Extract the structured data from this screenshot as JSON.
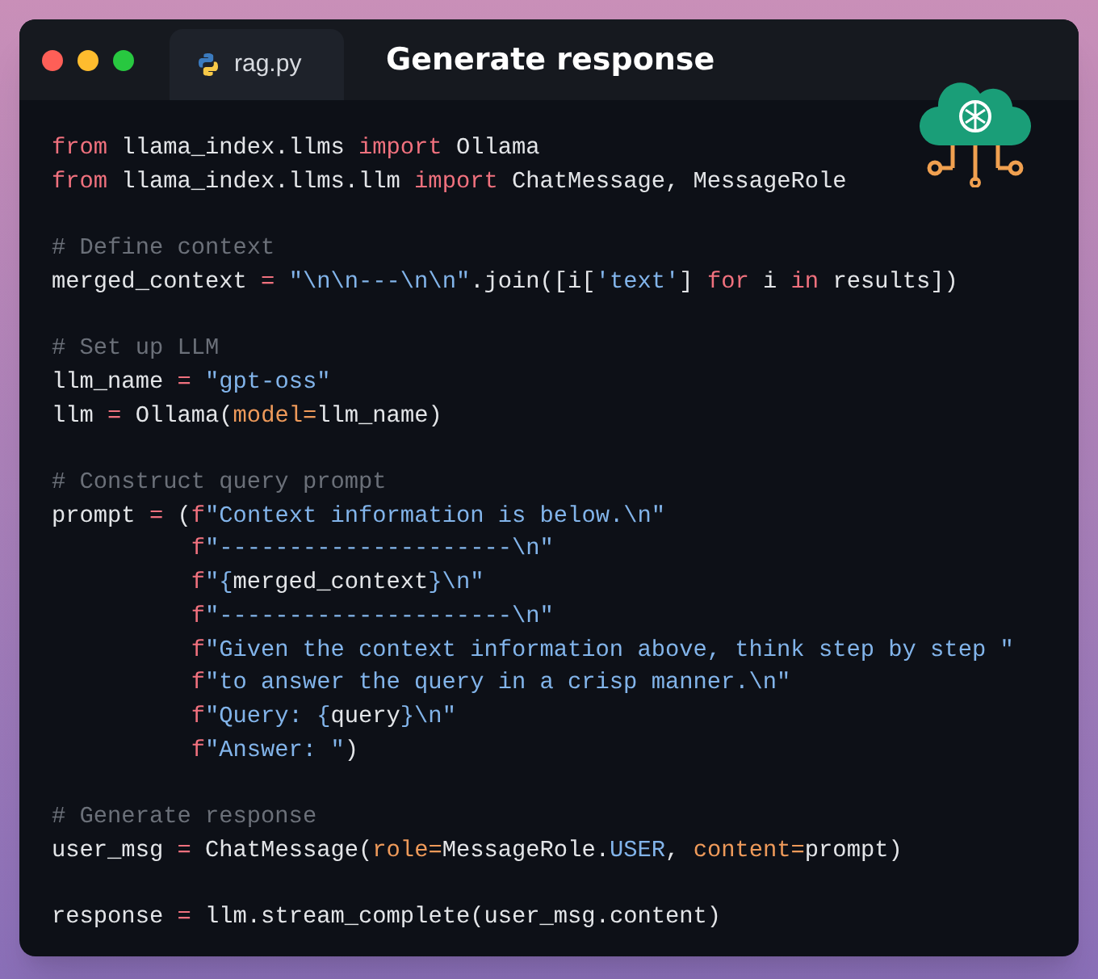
{
  "window": {
    "tab": {
      "label": "rag.py",
      "selected": true
    },
    "title": "Generate response"
  },
  "code": {
    "blocks": [
      {
        "lines": [
          {
            "indented": false,
            "tokens": [
              {
                "kind": "kw",
                "text": "from"
              },
              {
                "kind": "plain",
                "text": " llama_index.llms "
              },
              {
                "kind": "kw",
                "text": "import"
              },
              {
                "kind": "plain",
                "text": " Ollama"
              }
            ]
          },
          {
            "indented": false,
            "tokens": [
              {
                "kind": "kw",
                "text": "from"
              },
              {
                "kind": "plain",
                "text": " llama_index.llms.llm "
              },
              {
                "kind": "kw",
                "text": "import"
              },
              {
                "kind": "plain",
                "text": " ChatMessage, MessageRole"
              }
            ]
          }
        ]
      },
      {
        "lines": [
          {
            "indented": false,
            "tokens": [
              {
                "kind": "comment",
                "text": "# Define context"
              }
            ]
          },
          {
            "indented": false,
            "tokens": [
              {
                "kind": "plain",
                "text": "merged_context"
              },
              {
                "kind": "op",
                "text": " = "
              },
              {
                "kind": "str",
                "text": "\"\\n\\n---\\n\\n\""
              },
              {
                "kind": "plain",
                "text": ".join([i["
              },
              {
                "kind": "str",
                "text": "'text'"
              },
              {
                "kind": "plain",
                "text": "] "
              },
              {
                "kind": "kw",
                "text": "for"
              },
              {
                "kind": "plain",
                "text": " i "
              },
              {
                "kind": "kw",
                "text": "in"
              },
              {
                "kind": "plain",
                "text": " results])"
              }
            ]
          }
        ]
      },
      {
        "lines": [
          {
            "indented": false,
            "tokens": [
              {
                "kind": "comment",
                "text": "# Set up LLM"
              }
            ]
          },
          {
            "indented": false,
            "tokens": [
              {
                "kind": "plain",
                "text": "llm_name"
              },
              {
                "kind": "op",
                "text": " = "
              },
              {
                "kind": "str",
                "text": "\"gpt-oss\""
              }
            ]
          },
          {
            "indented": false,
            "tokens": [
              {
                "kind": "plain",
                "text": "llm"
              },
              {
                "kind": "op",
                "text": " = "
              },
              {
                "kind": "plain",
                "text": "Ollama("
              },
              {
                "kind": "param",
                "text": "model="
              },
              {
                "kind": "plain",
                "text": "llm_name)"
              }
            ]
          }
        ]
      },
      {
        "lines": [
          {
            "indented": false,
            "tokens": [
              {
                "kind": "comment",
                "text": "# Construct query prompt"
              }
            ]
          },
          {
            "indented": false,
            "tokens": [
              {
                "kind": "plain",
                "text": "prompt"
              },
              {
                "kind": "op",
                "text": " = "
              },
              {
                "kind": "plain",
                "text": "("
              },
              {
                "kind": "kw",
                "text": "f"
              },
              {
                "kind": "str",
                "text": "\"Context information is below.\\n\""
              }
            ]
          },
          {
            "indented": true,
            "tokens": [
              {
                "kind": "kw",
                "text": "f"
              },
              {
                "kind": "str",
                "text": "\"---------------------\\n\""
              }
            ]
          },
          {
            "indented": true,
            "tokens": [
              {
                "kind": "kw",
                "text": "f"
              },
              {
                "kind": "str",
                "text": "\"{"
              },
              {
                "kind": "plain",
                "text": "merged_context"
              },
              {
                "kind": "str",
                "text": "}\\n\""
              }
            ]
          },
          {
            "indented": true,
            "tokens": [
              {
                "kind": "kw",
                "text": "f"
              },
              {
                "kind": "str",
                "text": "\"---------------------\\n\""
              }
            ]
          },
          {
            "indented": true,
            "tokens": [
              {
                "kind": "kw",
                "text": "f"
              },
              {
                "kind": "str",
                "text": "\"Given the context information above, think step by step \""
              }
            ]
          },
          {
            "indented": true,
            "tokens": [
              {
                "kind": "kw",
                "text": "f"
              },
              {
                "kind": "str",
                "text": "\"to answer the query in a crisp manner.\\n\""
              }
            ]
          },
          {
            "indented": true,
            "tokens": [
              {
                "kind": "kw",
                "text": "f"
              },
              {
                "kind": "str",
                "text": "\"Query: {"
              },
              {
                "kind": "plain",
                "text": "query"
              },
              {
                "kind": "str",
                "text": "}\\n\""
              }
            ]
          },
          {
            "indented": true,
            "tokens": [
              {
                "kind": "kw",
                "text": "f"
              },
              {
                "kind": "str",
                "text": "\"Answer: \""
              },
              {
                "kind": "plain",
                "text": ")"
              }
            ]
          }
        ]
      },
      {
        "lines": [
          {
            "indented": false,
            "tokens": [
              {
                "kind": "comment",
                "text": "# Generate response"
              }
            ]
          },
          {
            "indented": false,
            "tokens": [
              {
                "kind": "plain",
                "text": "user_msg"
              },
              {
                "kind": "op",
                "text": " = "
              },
              {
                "kind": "plain",
                "text": "ChatMessage("
              },
              {
                "kind": "param",
                "text": "role="
              },
              {
                "kind": "plain",
                "text": "MessageRole."
              },
              {
                "kind": "str",
                "text": "USER"
              },
              {
                "kind": "plain",
                "text": ", "
              },
              {
                "kind": "param",
                "text": "content="
              },
              {
                "kind": "plain",
                "text": "prompt)"
              }
            ]
          }
        ]
      },
      {
        "lines": [
          {
            "indented": false,
            "tokens": [
              {
                "kind": "plain",
                "text": "response"
              },
              {
                "kind": "op",
                "text": " = "
              },
              {
                "kind": "plain",
                "text": "llm.stream_complete(user_msg.content)"
              }
            ]
          }
        ]
      }
    ]
  }
}
